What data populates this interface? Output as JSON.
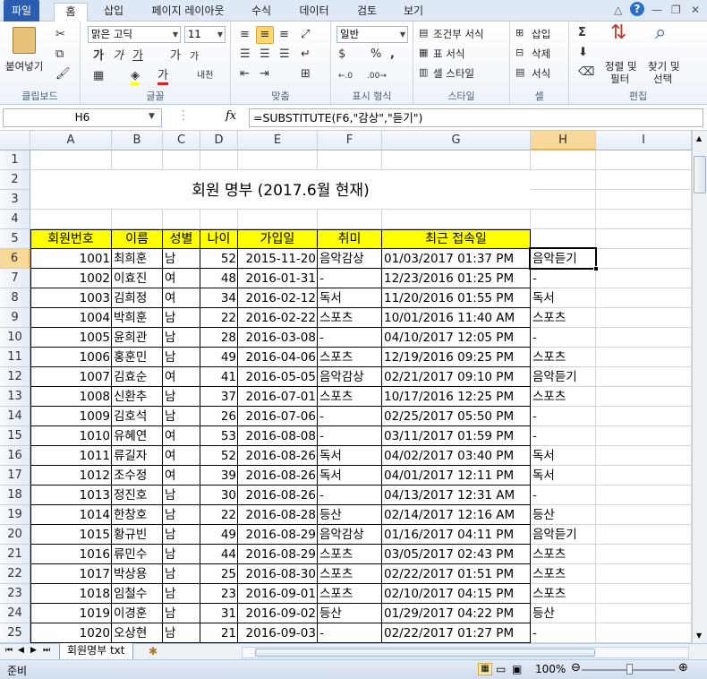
{
  "tabs": {
    "file": "파일",
    "home": "홈",
    "insert": "삽입",
    "page_layout": "페이지 레이아웃",
    "formulas": "수식",
    "data": "데이터",
    "review": "검토",
    "view": "보기"
  },
  "ribbon": {
    "clipboard": {
      "paste": "붙여넣기",
      "label": "클립보드"
    },
    "font": {
      "name": "맑은 고딕",
      "size": "11",
      "label": "글꼴",
      "bold": "가",
      "italic": "가",
      "underline": "가",
      "grow": "가",
      "shrink": "가",
      "color_a": "가",
      "phonetic": "내천"
    },
    "alignment": {
      "label": "맞춤"
    },
    "number": {
      "format": "일반",
      "percent": "%",
      "comma": ",",
      "label": "표시 형식"
    },
    "styles": {
      "conditional": "조건부 서식",
      "table": "표 서식",
      "cell": "셀 스타일",
      "label": "스타일"
    },
    "cells": {
      "insert": "삽입",
      "delete": "삭제",
      "format": "서식",
      "label": "셀"
    },
    "editing": {
      "sort": "정렬 및",
      "sort2": "필터",
      "find": "찾기 및",
      "find2": "선택",
      "label": "편집"
    }
  },
  "formula_bar": {
    "name_box": "H6",
    "fx": "fx",
    "formula": "=SUBSTITUTE(F6,\"감상\",\"듣기\")"
  },
  "grid": {
    "columns": [
      "A",
      "B",
      "C",
      "D",
      "E",
      "F",
      "G",
      "H",
      "I"
    ],
    "selected_column": "H",
    "selected_row": 6,
    "title": "회원 명부 (2017.6월 현재)",
    "headers": [
      "회원번호",
      "이름",
      "성별",
      "나이",
      "가입일",
      "취미",
      "최근 접속일"
    ],
    "rows": [
      [
        "1001",
        "최희훈",
        "남",
        "52",
        "2015-11-20",
        "음악감상",
        "01/03/2017 01:37 PM",
        "음악듣기"
      ],
      [
        "1002",
        "이효진",
        "여",
        "48",
        "2016-01-31",
        "-",
        "12/23/2016 01:25 PM",
        "-"
      ],
      [
        "1003",
        "김희정",
        "여",
        "34",
        "2016-02-12",
        "독서",
        "11/20/2016 01:55 PM",
        "독서"
      ],
      [
        "1004",
        "박희훈",
        "남",
        "22",
        "2016-02-22",
        "스포츠",
        "10/01/2016 11:40 AM",
        "스포츠"
      ],
      [
        "1005",
        "윤희관",
        "남",
        "28",
        "2016-03-08",
        "-",
        "04/10/2017 12:05 PM",
        "-"
      ],
      [
        "1006",
        "홍훈민",
        "남",
        "49",
        "2016-04-06",
        "스포츠",
        "12/19/2016 09:25 PM",
        "스포츠"
      ],
      [
        "1007",
        "김효순",
        "여",
        "41",
        "2016-05-05",
        "음악감상",
        "02/21/2017 09:10 PM",
        "음악듣기"
      ],
      [
        "1008",
        "신환추",
        "남",
        "37",
        "2016-07-01",
        "스포츠",
        "10/17/2016 12:25 PM",
        "스포츠"
      ],
      [
        "1009",
        "김호석",
        "남",
        "26",
        "2016-07-06",
        "-",
        "02/25/2017 05:50 PM",
        "-"
      ],
      [
        "1010",
        "유혜연",
        "여",
        "53",
        "2016-08-08",
        "-",
        "03/11/2017 01:59 PM",
        "-"
      ],
      [
        "1011",
        "류길자",
        "여",
        "52",
        "2016-08-26",
        "독서",
        "04/02/2017 03:40 PM",
        "독서"
      ],
      [
        "1012",
        "조수정",
        "여",
        "39",
        "2016-08-26",
        "독서",
        "04/01/2017 12:11 PM",
        "독서"
      ],
      [
        "1013",
        "정진호",
        "남",
        "30",
        "2016-08-26",
        "-",
        "04/13/2017 12:31 AM",
        "-"
      ],
      [
        "1014",
        "한창호",
        "남",
        "22",
        "2016-08-28",
        "등산",
        "02/14/2017 12:16 AM",
        "등산"
      ],
      [
        "1015",
        "황규빈",
        "남",
        "49",
        "2016-08-29",
        "음악감상",
        "01/16/2017 04:11 PM",
        "음악듣기"
      ],
      [
        "1016",
        "류민수",
        "남",
        "44",
        "2016-08-29",
        "스포츠",
        "03/05/2017 02:43 PM",
        "스포츠"
      ],
      [
        "1017",
        "박상용",
        "남",
        "25",
        "2016-08-30",
        "스포츠",
        "02/22/2017 01:51 PM",
        "스포츠"
      ],
      [
        "1018",
        "임철수",
        "남",
        "23",
        "2016-09-01",
        "스포츠",
        "02/10/2017 04:15 PM",
        "스포츠"
      ],
      [
        "1019",
        "이경훈",
        "남",
        "31",
        "2016-09-02",
        "등산",
        "01/29/2017 04:22 PM",
        "등산"
      ],
      [
        "1020",
        "오상현",
        "남",
        "21",
        "2016-09-03",
        "-",
        "02/22/2017 01:27 PM",
        "-"
      ]
    ]
  },
  "sheet_tab": "회원명부 txt",
  "status": {
    "ready": "준비",
    "zoom": "100%"
  },
  "colors": {
    "header_fill": "#ffff00",
    "file_tab": "#2a5db0",
    "selection_header": "#f9d99a"
  }
}
